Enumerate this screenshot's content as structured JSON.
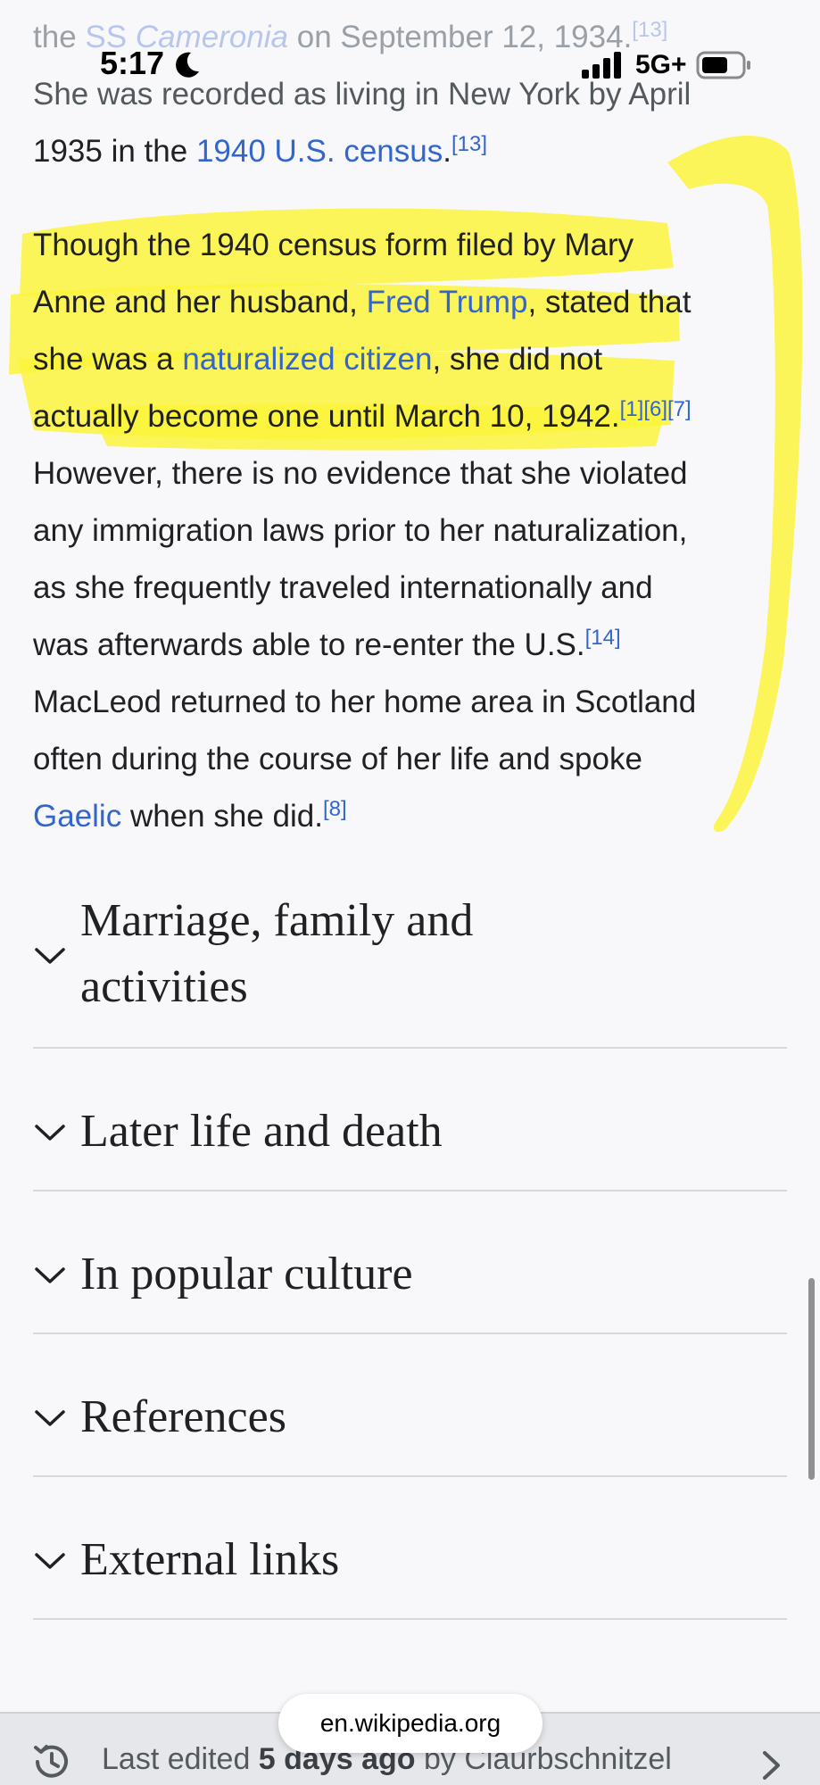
{
  "status_bar": {
    "time": "5:17",
    "network": "5G+",
    "icons": [
      "moon-icon",
      "signal-icon",
      "battery-icon"
    ]
  },
  "colors": {
    "link": "#3366cc",
    "highlighter": "#fbf43c",
    "background": "#f8f8fa"
  },
  "paragraph1": {
    "l1_pre": "the ",
    "l1_link1": "SS ",
    "l1_link1_italic": "Cameronia",
    "l1_post": " on September 12, 1934.",
    "l1_ref": "[13]",
    "l2": "She was recorded as living in New York by April",
    "l3_pre": "1935 in the ",
    "l3_link": "1940 U.S. census",
    "l3_post": ".",
    "l3_ref": "[13]"
  },
  "paragraph2": {
    "l1": "Though the 1940 census form filed by Mary",
    "l2_pre": "Anne and her husband, ",
    "l2_link": "Fred Trump",
    "l2_post": ", stated that",
    "l3_pre": "she was a ",
    "l3_link": "naturalized citizen",
    "l3_post": ", she did not",
    "l4": "actually become one until March 10, 1942.",
    "l4_refs": [
      "[1]",
      "[6]",
      "[7]"
    ],
    "l5": "However, there is no evidence that she violated",
    "l6": "any immigration laws prior to her naturalization,",
    "l7": "as she frequently traveled internationally and",
    "l8": "was afterwards able to re-enter the U.S.",
    "l8_ref": "[14]",
    "l9": "MacLeod returned to her home area in Scotland",
    "l10": "often during the course of her life and spoke",
    "l11_link": "Gaelic",
    "l11_post": " when she did.",
    "l11_ref": "[8]"
  },
  "sections": [
    {
      "title_line1": "Marriage, family and",
      "title_line2": "activities"
    },
    {
      "title": "Later life and death"
    },
    {
      "title": "In popular culture"
    },
    {
      "title": "References"
    },
    {
      "title": "External links"
    }
  ],
  "footer": {
    "last_edited_pre": "Last edited ",
    "last_edited_bold": "5 days ago",
    "last_edited_post": " by Claurbschnitzel",
    "url": "en.wikipedia.org"
  }
}
